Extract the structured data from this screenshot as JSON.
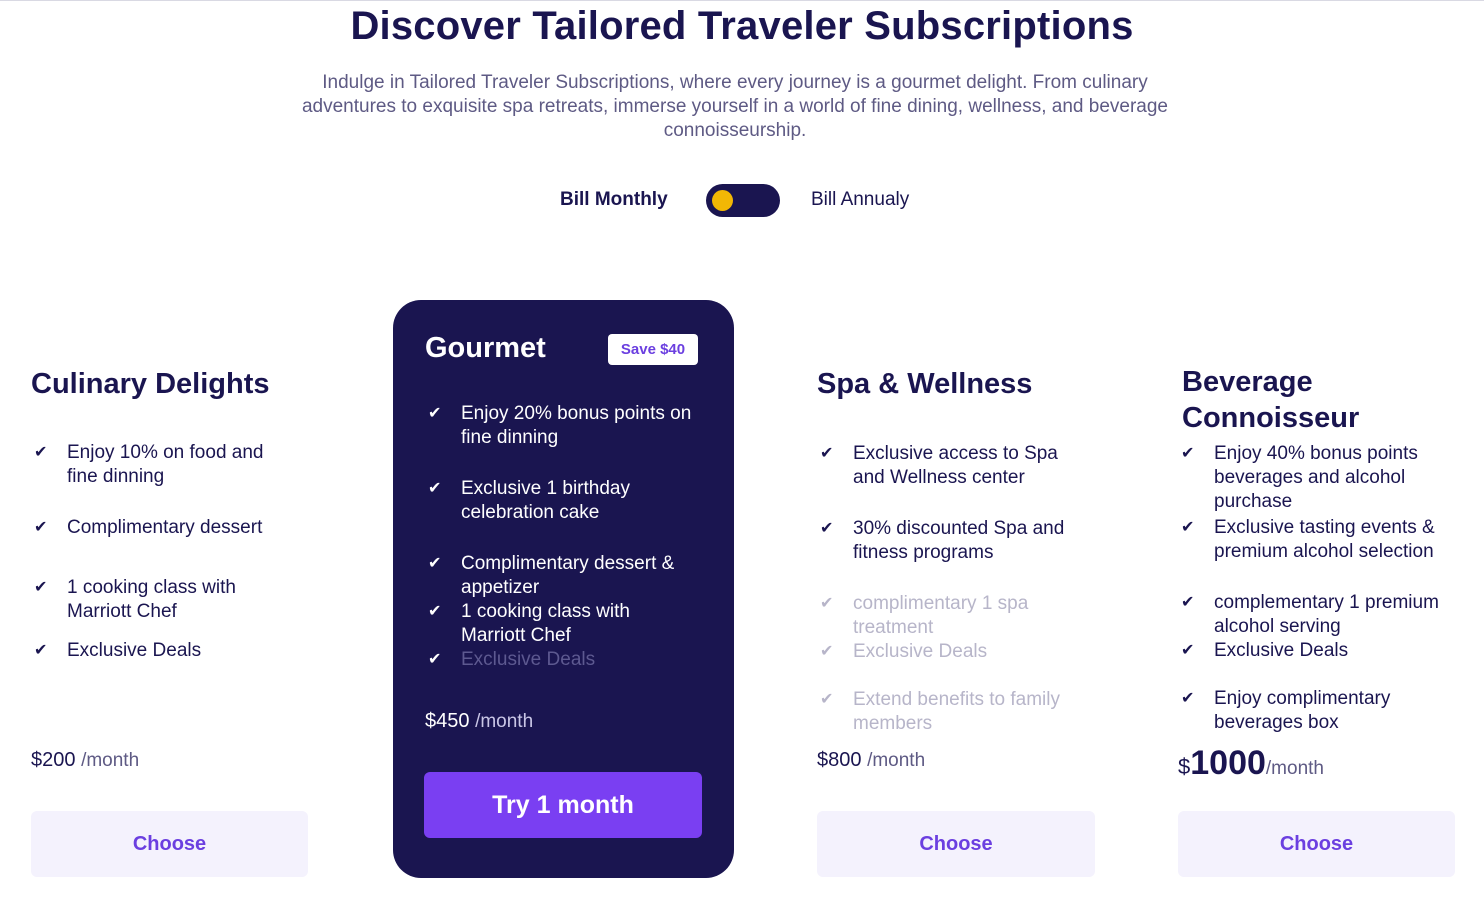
{
  "header": {
    "title": "Discover Tailored Traveler Subscriptions",
    "subtitle": "Indulge in Tailored Traveler Subscriptions, where every journey is a gourmet delight. From culinary adventures to exquisite spa retreats, immerse yourself in a world of fine dining, wellness, and beverage connoisseurship."
  },
  "billing": {
    "monthly_label": "Bill Monthly",
    "annual_label": "Bill Annualy",
    "selected": "monthly"
  },
  "colors": {
    "navy": "#1a1550",
    "accent": "#7a3ff2",
    "toggle_knob": "#f2b705",
    "button_bg": "#f4f2fd"
  },
  "icons": {
    "feature": "check-icon"
  },
  "plans": [
    {
      "name": "Culinary Delights",
      "features": [
        {
          "text": "Enjoy 10% on food and fine dinning",
          "included": true
        },
        {
          "text": "Complimentary dessert",
          "included": true
        },
        {
          "text": "1 cooking class with Marriott Chef",
          "included": true
        },
        {
          "text": "Exclusive Deals",
          "included": true
        }
      ],
      "price": "$200",
      "period": "/month",
      "cta": "Choose"
    },
    {
      "name": "Gourmet",
      "badge": "Save $40",
      "features": [
        {
          "text": "Enjoy 20% bonus points on fine dinning",
          "included": true
        },
        {
          "text": "Exclusive 1 birthday celebration cake",
          "included": true
        },
        {
          "text": "Complimentary dessert & appetizer",
          "included": true
        },
        {
          "text": "1 cooking class with Marriott Chef",
          "included": true
        },
        {
          "text": "Exclusive Deals",
          "included": false
        }
      ],
      "price": "$450",
      "period": "/month",
      "cta": "Try 1 month"
    },
    {
      "name": "Spa & Wellness",
      "features": [
        {
          "text": "Exclusive access to Spa and Wellness center",
          "included": true
        },
        {
          "text": "30% discounted Spa and fitness programs",
          "included": true
        },
        {
          "text": "complimentary 1 spa treatment",
          "included": false
        },
        {
          "text": "Exclusive Deals",
          "included": false
        },
        {
          "text": "Extend benefits to family members",
          "included": false
        }
      ],
      "price": "$800",
      "period": "/month",
      "cta": "Choose"
    },
    {
      "name": "Beverage Connoisseur",
      "features": [
        {
          "text": "Enjoy 40% bonus points beverages and alcohol purchase",
          "included": true
        },
        {
          "text": "Exclusive tasting events & premium alcohol selection",
          "included": true
        },
        {
          "text": "complementary 1 premium alcohol serving",
          "included": true
        },
        {
          "text": "Exclusive Deals",
          "included": true
        },
        {
          "text": "Enjoy complimentary beverages box",
          "included": true
        }
      ],
      "price_symbol": "$",
      "price_amount": "1000",
      "period": "/month",
      "cta": "Choose"
    }
  ]
}
